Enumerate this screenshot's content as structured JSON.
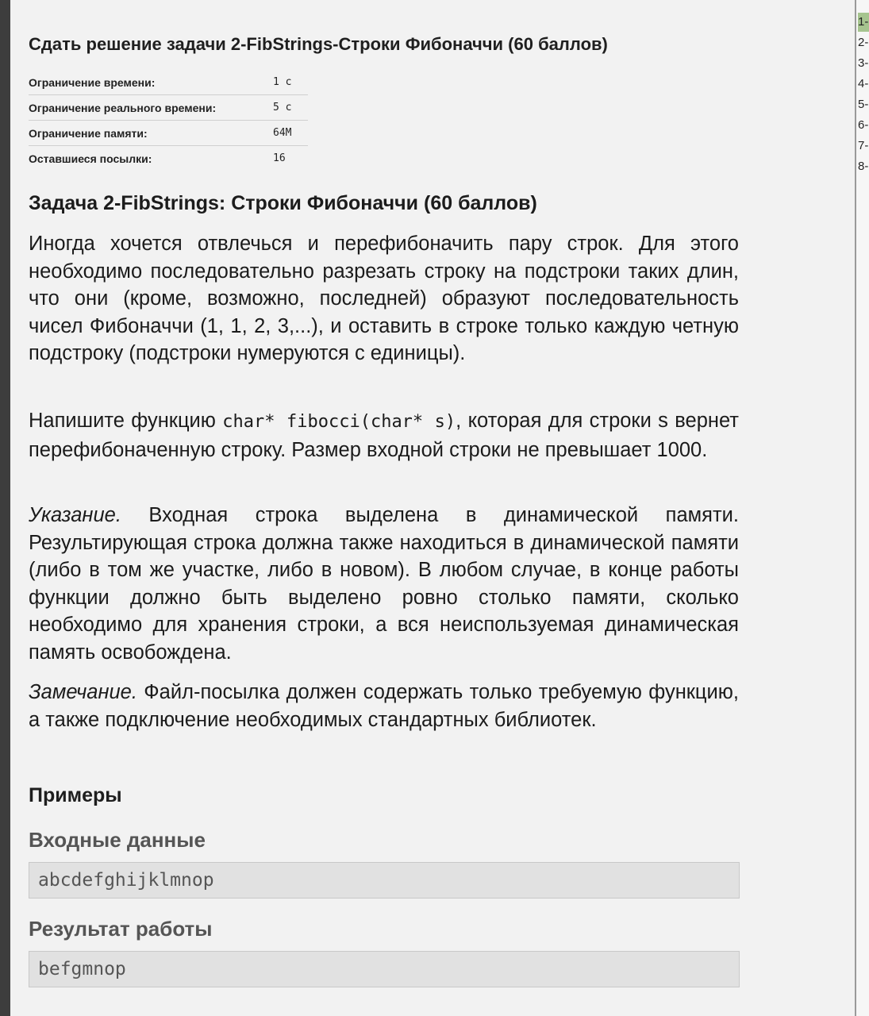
{
  "submit_title": "Сдать решение задачи 2-FibStrings-Строки Фибоначчи (60 баллов)",
  "limits": [
    {
      "label": "Ограничение времени:",
      "value": "1 с"
    },
    {
      "label": "Ограничение реального времени:",
      "value": "5 с"
    },
    {
      "label": "Ограничение памяти:",
      "value": "64M"
    },
    {
      "label": "Оставшиеся посылки:",
      "value": "16"
    }
  ],
  "problem": {
    "title": "Задача 2-FibStrings: Строки Фибоначчи (60 баллов)",
    "intro": "Иногда хочется отвлечься и перефибоначить пару строк. Для этого необходимо последовательно разрезать строку на подстроки таких длин, что они (кроме, возможно, последней) образуют последовательность чисел Фибоначчи (1, 1, 2, 3,...), и оставить в строке только каждую четную подстроку (подстроки нумеруются с единицы).",
    "task_before": "Напишите функцию ",
    "task_code": "char* fibocci(char* s)",
    "task_after": ", которая для строки s вернет перефибоначенную строку. Размер входной строки не превышает 1000.",
    "hint_label": "Указание.",
    "hint_text": " Входная строка выделена в динамической памяти. Результирующая строка должна также находиться в динамической памяти (либо в том же участке, либо в новом). В любом случае, в конце работы функции должно быть выделено ровно столько памяти, сколько необходимо для хранения строки, а вся неиспользуемая динамическая память освобождена.",
    "note_label": "Замечание.",
    "note_text": " Файл-посылка должен содержать только требуемую функцию, а также подключение необходимых стандартных библиотек."
  },
  "examples": {
    "title": "Примеры",
    "input_title": "Входные данные",
    "input_value": "abcdefghijklmnop",
    "output_title": "Результат работы",
    "output_value": "befgmnop"
  },
  "side_list": [
    "1-",
    "2-",
    "3-",
    "4-",
    "5-",
    "6-",
    "7-",
    "8-"
  ],
  "colors": {
    "active_item": "#a6c48f",
    "background": "#f2f2f2",
    "code_box": "#e1e1e1"
  }
}
